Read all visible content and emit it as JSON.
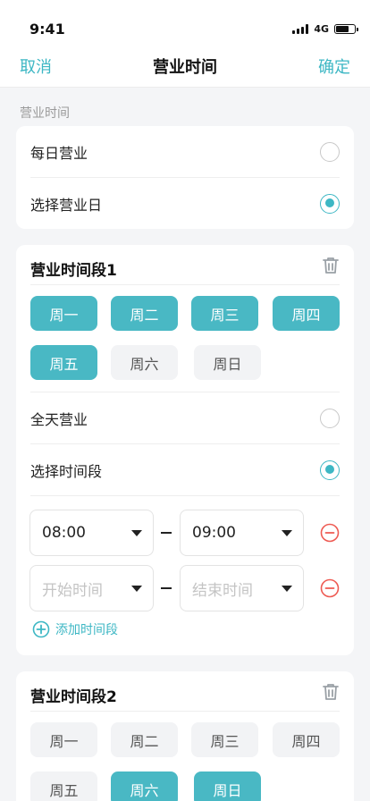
{
  "status": {
    "time": "9:41",
    "network": "4G"
  },
  "nav": {
    "cancel": "取消",
    "title": "营业时间",
    "confirm": "确定"
  },
  "section_label": "营业时间",
  "mode": {
    "options": [
      {
        "label": "每日营业",
        "selected": false
      },
      {
        "label": "选择营业日",
        "selected": true
      }
    ]
  },
  "periods": [
    {
      "title": "营业时间段1",
      "days": [
        {
          "label": "周一",
          "selected": true
        },
        {
          "label": "周二",
          "selected": true
        },
        {
          "label": "周三",
          "selected": true
        },
        {
          "label": "周四",
          "selected": true
        },
        {
          "label": "周五",
          "selected": true
        },
        {
          "label": "周六",
          "selected": false
        },
        {
          "label": "周日",
          "selected": false
        }
      ],
      "all_day": {
        "label": "全天营业",
        "selected": false
      },
      "select_range": {
        "label": "选择时间段",
        "selected": true
      },
      "ranges": [
        {
          "start": "08:00",
          "end": "09:00"
        },
        {
          "start_placeholder": "开始时间",
          "end_placeholder": "结束时间"
        }
      ],
      "add_label": "添加时间段"
    },
    {
      "title": "营业时间段2",
      "days": [
        {
          "label": "周一",
          "selected": false
        },
        {
          "label": "周二",
          "selected": false
        },
        {
          "label": "周三",
          "selected": false
        },
        {
          "label": "周四",
          "selected": false
        },
        {
          "label": "周五",
          "selected": false
        },
        {
          "label": "周六",
          "selected": true
        },
        {
          "label": "周日",
          "selected": true
        }
      ]
    }
  ],
  "colors": {
    "accent": "#3db7c4",
    "chip_on": "#49b8c4",
    "danger": "#ee5a52"
  }
}
